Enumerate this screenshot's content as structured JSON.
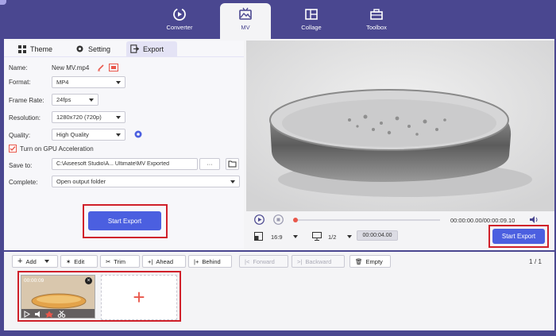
{
  "nav": {
    "tabs": [
      {
        "label": "Converter"
      },
      {
        "label": "MV"
      },
      {
        "label": "Collage"
      },
      {
        "label": "Toolbox"
      }
    ]
  },
  "subtabs": {
    "theme": "Theme",
    "setting": "Setting",
    "export": "Export"
  },
  "form": {
    "name_label": "Name:",
    "name_value": "New MV.mp4",
    "format_label": "Format:",
    "format_value": "MP4",
    "framerate_label": "Frame Rate:",
    "framerate_value": "24fps",
    "resolution_label": "Resolution:",
    "resolution_value": "1280x720 (720p)",
    "quality_label": "Quality:",
    "quality_value": "High Quality",
    "gpu_label": "Turn on GPU Acceleration",
    "saveto_label": "Save to:",
    "saveto_value": "C:\\Aiseesoft Studio\\A... Ultimate\\MV Exported",
    "saveto_more": "···",
    "complete_label": "Complete:",
    "complete_value": "Open output folder",
    "start_export": "Start Export"
  },
  "player": {
    "time": "00:00:00.00/00:00:09.10",
    "ratio": "16:9",
    "zoom": "1/2",
    "duration": "00:00:04.00",
    "start_export": "Start Export",
    "progress": 0.0
  },
  "toolbar": {
    "add": "Add",
    "edit": "Edit",
    "trim": "Trim",
    "ahead": "Ahead",
    "behind": "Behind",
    "forward": "Forward",
    "backward": "Backward",
    "empty": "Empty",
    "page": "1",
    "page_total": "/ 1"
  },
  "timeline": {
    "clip_time": "00:00:09",
    "add_symbol": "+"
  },
  "colors": {
    "brand": "#4a4790",
    "accent": "#4b5fe0",
    "highlight": "#d0202a",
    "record": "#e9574b"
  }
}
